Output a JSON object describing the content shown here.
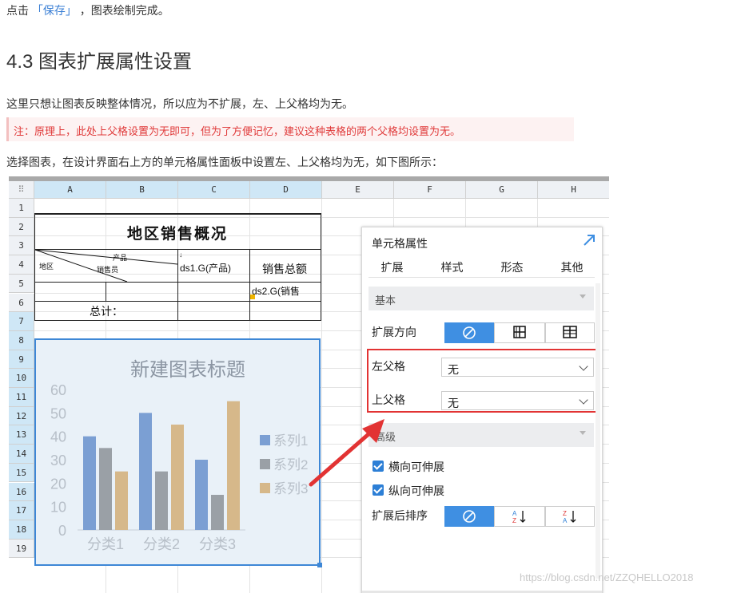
{
  "article": {
    "line1_prefix": "点击",
    "line1_keyword": "「保存」",
    "line1_suffix": "，图表绘制完成。",
    "heading": "4.3 图表扩展属性设置",
    "para1": "这里只想让图表反映整体情况，所以应为不扩展，左、上父格均为无。",
    "note": "注：原理上，此处上父格设置为无即可，但为了方便记忆，建议这种表格的两个父格均设置为无。",
    "para2": "选择图表，在设计界面右上方的单元格属性面板中设置左、上父格均为无，如下图所示："
  },
  "sheet": {
    "corner": "⠿",
    "columns": [
      "A",
      "B",
      "C",
      "D",
      "E",
      "F",
      "G",
      "H"
    ],
    "rows": [
      "1",
      "2",
      "3",
      "4",
      "5",
      "6",
      "7",
      "8",
      "9",
      "10",
      "11",
      "12",
      "13",
      "14",
      "15",
      "16",
      "17",
      "18",
      "19"
    ],
    "title": "地区销售概况",
    "diag_product": "产品",
    "diag_region": "地区",
    "diag_sales": "销售员",
    "c3_value": "ds1.G(产品)",
    "d3_value": "销售总额",
    "d4_value": "ds2.G(销售",
    "total_label": "总计："
  },
  "chart_data": {
    "type": "bar",
    "title": "新建图表标题",
    "categories": [
      "分类1",
      "分类2",
      "分类3"
    ],
    "series": [
      {
        "name": "系列1",
        "values": [
          40,
          50,
          30
        ],
        "color": "#7b9fd3"
      },
      {
        "name": "系列2",
        "values": [
          35,
          25,
          15
        ],
        "color": "#9aa0a6"
      },
      {
        "name": "系列3",
        "values": [
          25,
          45,
          55
        ],
        "color": "#d6b88a"
      }
    ],
    "yticks": [
      "0",
      "10",
      "20",
      "30",
      "40",
      "50",
      "60"
    ],
    "ylim": [
      0,
      60
    ],
    "legend_position": "right",
    "grid": false
  },
  "panel": {
    "title": "单元格属性",
    "tabs": [
      "扩展",
      "样式",
      "形态",
      "其他"
    ],
    "section_basic": "基本",
    "expand_direction_label": "扩展方向",
    "left_parent_label": "左父格",
    "left_parent_value": "无",
    "top_parent_label": "上父格",
    "top_parent_value": "无",
    "section_advanced": "高级",
    "horizontal_extend": "横向可伸展",
    "vertical_extend": "纵向可伸展",
    "sort_label": "扩展后排序",
    "bottom_handle": "···"
  },
  "colors": {
    "accent": "#3f8fe2",
    "highlight_box": "#e23333",
    "note_text": "#e03a3a"
  },
  "watermark": "https://blog.csdn.net/ZZQHELLO2018"
}
